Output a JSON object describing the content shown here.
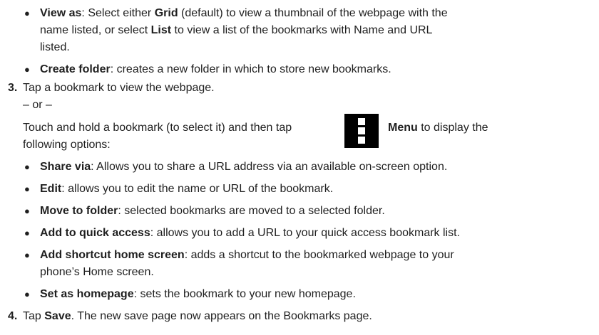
{
  "items": {
    "view_as": {
      "title": "View as",
      "p1": ": Select either ",
      "grid": "Grid",
      "p2": " (default) to view a thumbnail of the webpage with the",
      "line2": "name listed, or select ",
      "list": "List",
      "p3": " to view a list of the bookmarks with Name and URL",
      "line3": "listed."
    },
    "create_folder": {
      "title": "Create folder",
      "desc": ": creates a new folder in which to store new bookmarks."
    },
    "step3": {
      "number": "3.",
      "text": "Tap a bookmark to view the webpage.",
      "or": "– or –",
      "line_a": "Touch and hold a bookmark (to select it) and then tap",
      "menu": "Menu",
      "line_a_end": " to display the",
      "line_b": "following options:"
    },
    "share_via": {
      "title": "Share via",
      "desc": ": Allows you to share a URL address via an available on-screen option."
    },
    "edit": {
      "title": "Edit",
      "desc": ": allows you to edit the name or URL of the bookmark."
    },
    "move_folder": {
      "title": "Move to folder",
      "desc": ": selected bookmarks are moved to a selected folder."
    },
    "quick_access": {
      "title": "Add to quick access",
      "desc": ": allows you to add a URL to your quick access bookmark list."
    },
    "shortcut": {
      "title": "Add shortcut home screen",
      "desc": ": adds a shortcut to the bookmarked webpage to your",
      "line2": "phone’s Home screen."
    },
    "homepage": {
      "title": "Set as homepage",
      "desc": ": sets the bookmark to your new homepage."
    },
    "step4": {
      "number": "4.",
      "p1": "Tap ",
      "save": "Save",
      "p2": ". The new save page now appears on the Bookmarks page."
    }
  },
  "bullet_glyph": "●",
  "menu_icon": "menu-icon"
}
